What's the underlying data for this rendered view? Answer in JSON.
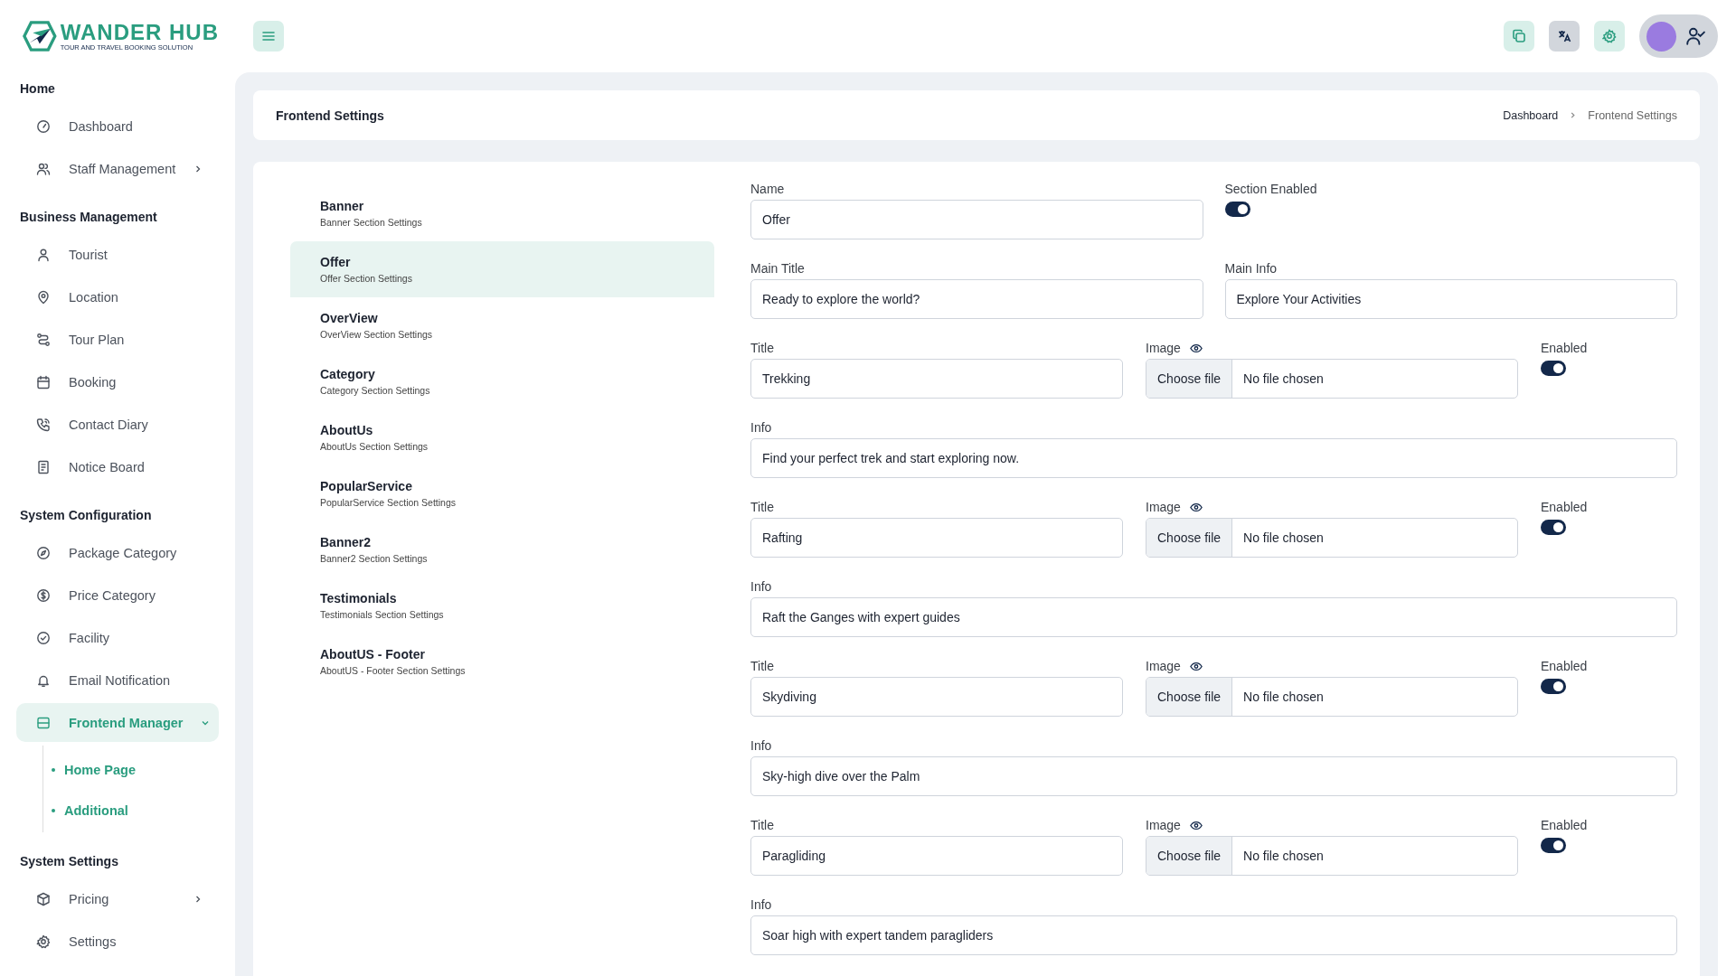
{
  "brand": {
    "name": "WANDER HUB",
    "tagline": "TOUR AND TRAVEL BOOKING SOLUTION"
  },
  "sidebar": {
    "groups": [
      {
        "heading": "Home",
        "items": [
          {
            "label": "Dashboard",
            "selected": false,
            "expandable": false
          },
          {
            "label": "Staff Management",
            "selected": false,
            "expandable": true,
            "expanded": false
          }
        ]
      },
      {
        "heading": "Business Management",
        "items": [
          {
            "label": "Tourist",
            "selected": false,
            "expandable": false
          },
          {
            "label": "Location",
            "selected": false,
            "expandable": false
          },
          {
            "label": "Tour Plan",
            "selected": false,
            "expandable": false
          },
          {
            "label": "Booking",
            "selected": false,
            "expandable": false
          },
          {
            "label": "Contact Diary",
            "selected": false,
            "expandable": false
          },
          {
            "label": "Notice Board",
            "selected": false,
            "expandable": false
          }
        ]
      },
      {
        "heading": "System Configuration",
        "items": [
          {
            "label": "Package Category",
            "selected": false,
            "expandable": false
          },
          {
            "label": "Price Category",
            "selected": false,
            "expandable": false
          },
          {
            "label": "Facility",
            "selected": false,
            "expandable": false
          },
          {
            "label": "Email Notification",
            "selected": false,
            "expandable": false
          },
          {
            "label": "Frontend Manager",
            "selected": true,
            "expandable": true,
            "expanded": true,
            "children": [
              {
                "label": "Home Page"
              },
              {
                "label": "Additional"
              }
            ]
          }
        ]
      },
      {
        "heading": "System Settings",
        "items": [
          {
            "label": "Pricing",
            "selected": false,
            "expandable": true,
            "expanded": false
          },
          {
            "label": "Settings",
            "selected": false,
            "expandable": false
          }
        ]
      }
    ]
  },
  "page_title": "Frontend Settings",
  "breadcrumb": [
    "Dashboard",
    "Frontend Settings"
  ],
  "sections": [
    {
      "title": "Banner",
      "subtitle": "Banner Section Settings",
      "selected": false
    },
    {
      "title": "Offer",
      "subtitle": "Offer Section Settings",
      "selected": true
    },
    {
      "title": "OverView",
      "subtitle": "OverView Section Settings",
      "selected": false
    },
    {
      "title": "Category",
      "subtitle": "Category Section Settings",
      "selected": false
    },
    {
      "title": "AboutUs",
      "subtitle": "AboutUs Section Settings",
      "selected": false
    },
    {
      "title": "PopularService",
      "subtitle": "PopularService Section Settings",
      "selected": false
    },
    {
      "title": "Banner2",
      "subtitle": "Banner2 Section Settings",
      "selected": false
    },
    {
      "title": "Testimonials",
      "subtitle": "Testimonials Section Settings",
      "selected": false
    },
    {
      "title": "AboutUS - Footer",
      "subtitle": "AboutUS - Footer Section Settings",
      "selected": false
    }
  ],
  "form": {
    "name": {
      "label": "Name",
      "value": "Offer"
    },
    "section_enabled": {
      "label": "Section Enabled",
      "on": true
    },
    "main_title": {
      "label": "Main Title",
      "value": "Ready to explore the world?"
    },
    "main_info": {
      "label": "Main Info",
      "value": "Explore Your Activities"
    },
    "activities": [
      {
        "title_label": "Title",
        "title": "Trekking",
        "image_label": "Image",
        "file_button": "Choose file",
        "file_status": "No file chosen",
        "enabled_label": "Enabled",
        "on": true,
        "info_label": "Info",
        "info": "Find your perfect trek and start exploring now."
      },
      {
        "title_label": "Title",
        "title": "Rafting",
        "image_label": "Image",
        "file_button": "Choose file",
        "file_status": "No file chosen",
        "enabled_label": "Enabled",
        "on": true,
        "info_label": "Info",
        "info": "Raft the Ganges with expert guides"
      },
      {
        "title_label": "Title",
        "title": "Skydiving",
        "image_label": "Image",
        "file_button": "Choose file",
        "file_status": "No file chosen",
        "enabled_label": "Enabled",
        "on": true,
        "info_label": "Info",
        "info": "Sky-high dive over the Palm"
      },
      {
        "title_label": "Title",
        "title": "Paragliding",
        "image_label": "Image",
        "file_button": "Choose file",
        "file_status": "No file chosen",
        "enabled_label": "Enabled",
        "on": true,
        "info_label": "Info",
        "info": "Soar high with expert tandem paragliders"
      }
    ]
  }
}
